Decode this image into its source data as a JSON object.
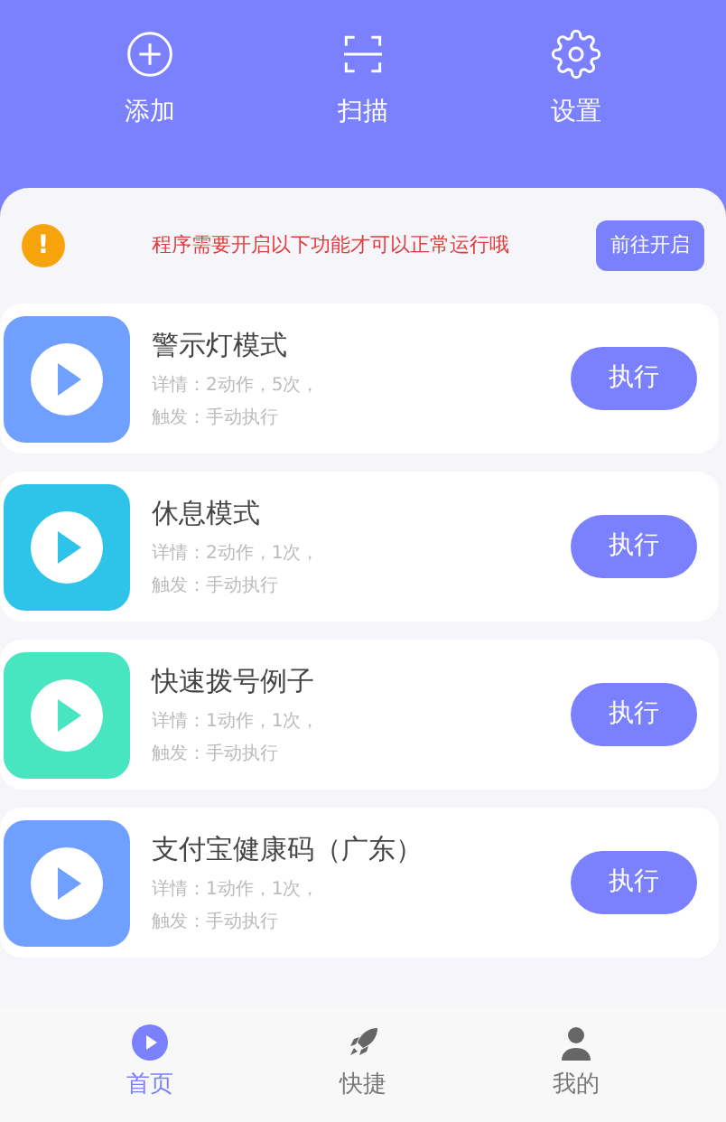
{
  "top_actions": [
    {
      "kind": "add",
      "label": "添加"
    },
    {
      "kind": "scan",
      "label": "扫描"
    },
    {
      "kind": "settings",
      "label": "设置"
    }
  ],
  "notice": {
    "icon": "!",
    "text": "程序需要开启以下功能才可以正常运行哦",
    "button": "前往开启"
  },
  "tasks": [
    {
      "title": "警示灯模式",
      "details": "详情：2动作，5次，",
      "trigger": "触发：手动执行",
      "color": "#6fa0ff",
      "button": "执行"
    },
    {
      "title": "休息模式",
      "details": "详情：2动作，1次，",
      "trigger": "触发：手动执行",
      "color": "#2ec4ea",
      "button": "执行"
    },
    {
      "title": "快速拨号例子",
      "details": "详情：1动作，1次，",
      "trigger": "触发：手动执行",
      "color": "#47e6c0",
      "button": "执行"
    },
    {
      "title": "支付宝健康码（广东）",
      "details": "详情：1动作，1次，",
      "trigger": "触发：手动执行",
      "color": "#6fa0ff",
      "button": "执行"
    }
  ],
  "tab_bar": [
    {
      "kind": "home",
      "label": "首页",
      "selected": true
    },
    {
      "kind": "rocket",
      "label": "快捷",
      "selected": false
    },
    {
      "kind": "person",
      "label": "我的",
      "selected": false
    }
  ]
}
